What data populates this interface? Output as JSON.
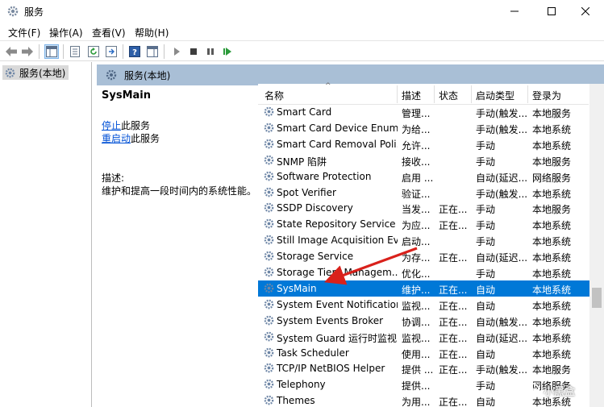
{
  "window": {
    "title": "服务"
  },
  "menu": {
    "items": [
      "文件(F)",
      "操作(A)",
      "查看(V)",
      "帮助(H)"
    ]
  },
  "tree": {
    "selected_label": "服务(本地)"
  },
  "content_header": {
    "title": "服务(本地)"
  },
  "details": {
    "service_name": "SysMain",
    "stop_link": "停止",
    "stop_suffix": "此服务",
    "restart_link": "重启动",
    "restart_suffix": "此服务",
    "description_label": "描述:",
    "description_text": "维护和提高一段时间内的系统性能。"
  },
  "columns": {
    "name": "名称",
    "description": "描述",
    "status": "状态",
    "startup": "启动类型",
    "logon": "登录为"
  },
  "services": [
    {
      "name": "Smart Card",
      "description": "管理...",
      "status": "",
      "startup": "手动(触发...",
      "logon": "本地服务"
    },
    {
      "name": "Smart Card Device Enum...",
      "description": "为给...",
      "status": "",
      "startup": "手动(触发...",
      "logon": "本地系统"
    },
    {
      "name": "Smart Card Removal Poli...",
      "description": "允许...",
      "status": "",
      "startup": "手动",
      "logon": "本地系统"
    },
    {
      "name": "SNMP 陷阱",
      "description": "接收...",
      "status": "",
      "startup": "手动",
      "logon": "本地服务"
    },
    {
      "name": "Software Protection",
      "description": "启用 ...",
      "status": "",
      "startup": "自动(延迟...",
      "logon": "网络服务"
    },
    {
      "name": "Spot Verifier",
      "description": "验证...",
      "status": "",
      "startup": "手动(触发...",
      "logon": "本地系统"
    },
    {
      "name": "SSDP Discovery",
      "description": "当发...",
      "status": "正在...",
      "startup": "手动",
      "logon": "本地服务"
    },
    {
      "name": "State Repository Service",
      "description": "为应...",
      "status": "正在...",
      "startup": "手动",
      "logon": "本地系统"
    },
    {
      "name": "Still Image Acquisition Ev...",
      "description": "启动...",
      "status": "",
      "startup": "手动",
      "logon": "本地系统"
    },
    {
      "name": "Storage Service",
      "description": "为存...",
      "status": "正在...",
      "startup": "自动(延迟...",
      "logon": "本地系统"
    },
    {
      "name": "Storage Tiers Managem...",
      "description": "优化...",
      "status": "",
      "startup": "手动",
      "logon": "本地系统"
    },
    {
      "name": "SysMain",
      "description": "维护...",
      "status": "正在...",
      "startup": "自动",
      "logon": "本地系统"
    },
    {
      "name": "System Event Notification...",
      "description": "监视...",
      "status": "正在...",
      "startup": "自动",
      "logon": "本地系统"
    },
    {
      "name": "System Events Broker",
      "description": "协调...",
      "status": "正在...",
      "startup": "自动(触发...",
      "logon": "本地系统"
    },
    {
      "name": "System Guard 运行时监视...",
      "description": "监视...",
      "status": "正在...",
      "startup": "自动(延迟...",
      "logon": "本地系统"
    },
    {
      "name": "Task Scheduler",
      "description": "使用...",
      "status": "正在...",
      "startup": "自动",
      "logon": "本地系统"
    },
    {
      "name": "TCP/IP NetBIOS Helper",
      "description": "提供 ...",
      "status": "正在...",
      "startup": "手动(触发...",
      "logon": "本地服务"
    },
    {
      "name": "Telephony",
      "description": "提供...",
      "status": "",
      "startup": "手动",
      "logon": "网络服务"
    },
    {
      "name": "Themes",
      "description": "为用...",
      "status": "正在...",
      "startup": "自动",
      "logon": "本地系统"
    }
  ],
  "selected_service": "SysMain",
  "watermark": {
    "text": "小黑盒"
  },
  "colors": {
    "selection": "#0078d7",
    "header_band": "#a9bfd6",
    "link": "#0050d6",
    "arrow": "#d9211b"
  }
}
